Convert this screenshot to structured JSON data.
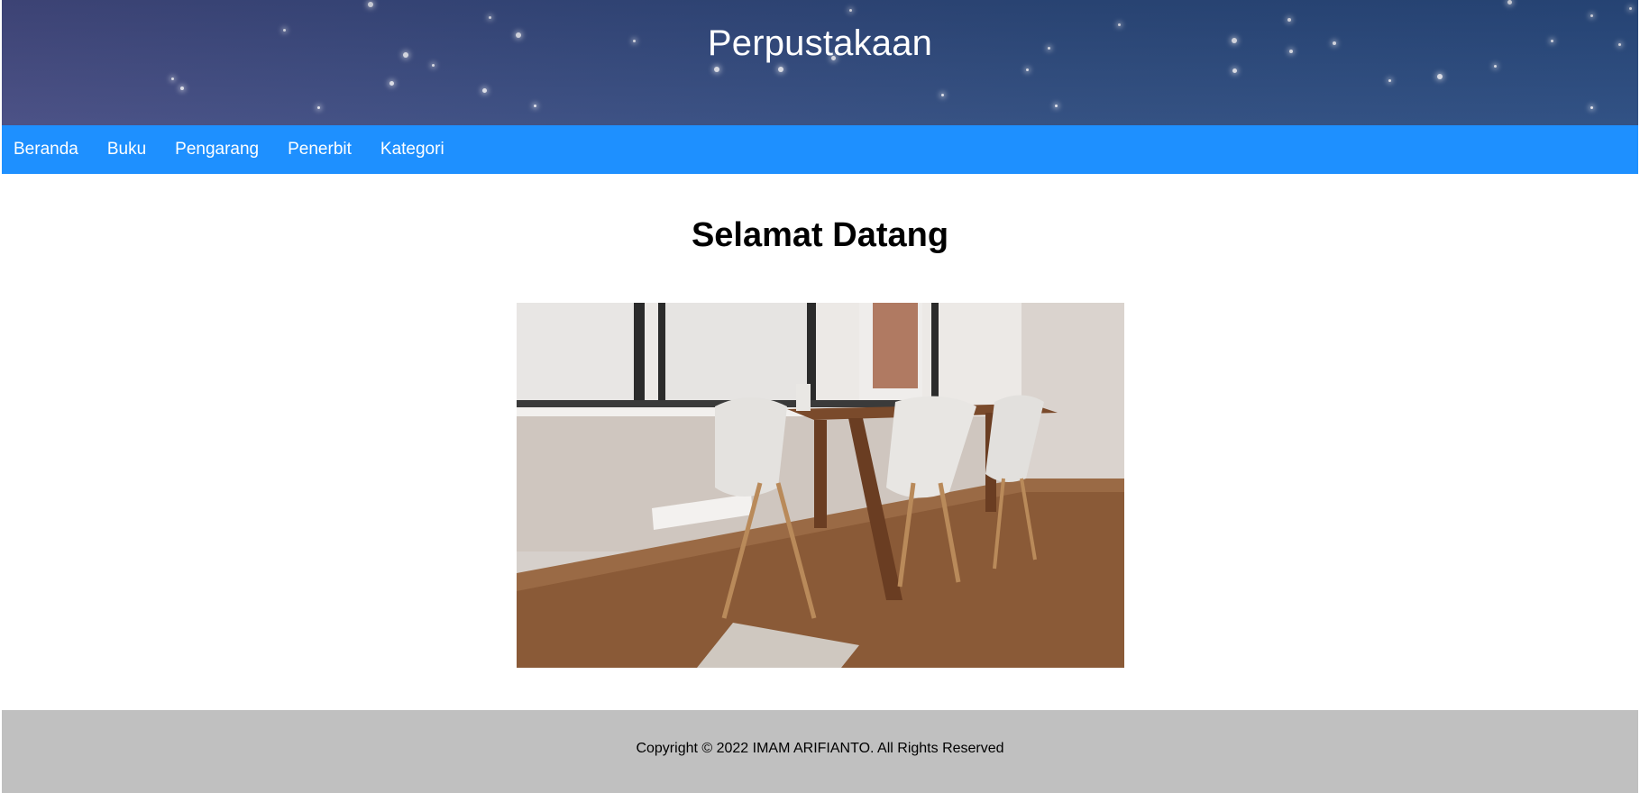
{
  "header": {
    "title": "Perpustakaan"
  },
  "nav": {
    "items": [
      {
        "label": "Beranda"
      },
      {
        "label": "Buku"
      },
      {
        "label": "Pengarang"
      },
      {
        "label": "Penerbit"
      },
      {
        "label": "Kategori"
      }
    ]
  },
  "main": {
    "heading": "Selamat Datang",
    "image_alt": "dining-room-photo"
  },
  "footer": {
    "copyright": "Copyright © 2022 IMAM ARIFIANTO. All Rights Reserved"
  },
  "colors": {
    "nav_bg": "#1e90ff",
    "header_bg": "#354f82",
    "footer_bg": "#c0c0c0"
  }
}
